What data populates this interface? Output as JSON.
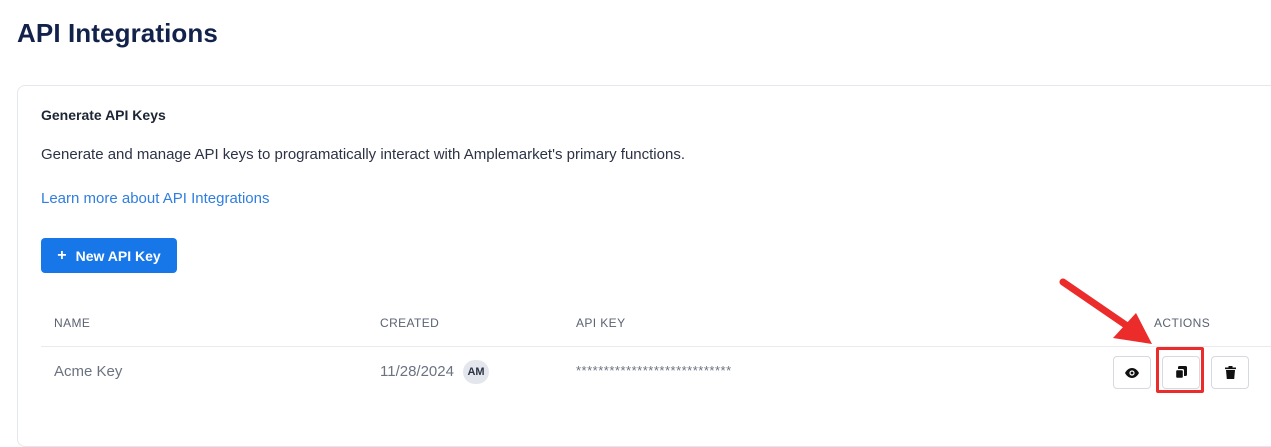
{
  "page": {
    "title": "API Integrations"
  },
  "card": {
    "title": "Generate API Keys",
    "description": "Generate and manage API keys to programatically interact with Amplemarket's primary functions.",
    "learn_more_link": "Learn more about API Integrations",
    "new_key_button": {
      "icon": "plus-icon",
      "label": "New API Key"
    }
  },
  "table": {
    "columns": [
      "NAME",
      "CREATED",
      "API KEY",
      "ACTIONS"
    ],
    "rows": [
      {
        "name": "Acme Key",
        "created": "11/28/2024",
        "creator_initials": "AM",
        "api_key": "****************************",
        "actions": [
          "eye-icon",
          "copy-icon",
          "trash-icon"
        ]
      }
    ]
  },
  "annotation": {
    "color": "#ec2b2b",
    "target": "copy-icon"
  },
  "colors": {
    "primary": "#1877e8",
    "link": "#2f7ee0",
    "title": "#13224a"
  }
}
